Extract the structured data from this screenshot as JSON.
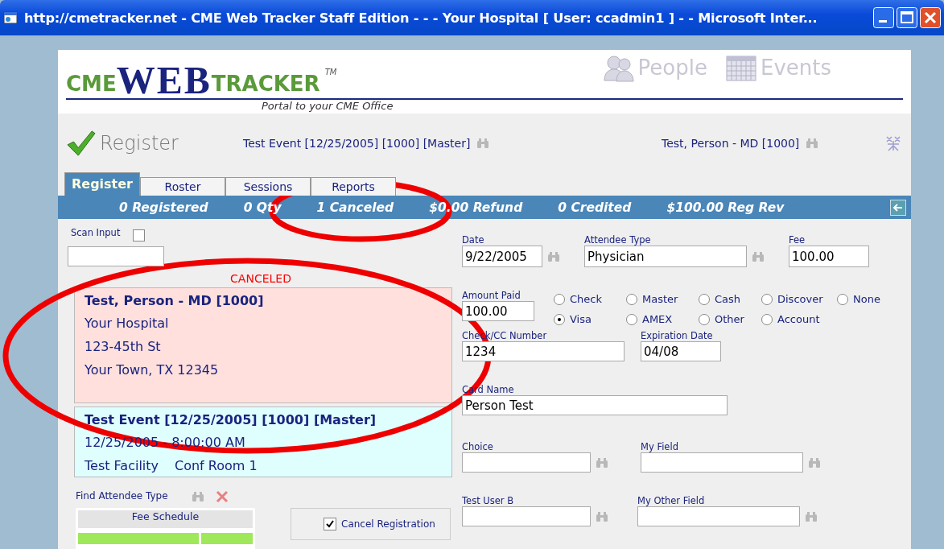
{
  "window": {
    "title": "http://cmetracker.net - CME Web Tracker Staff Edition - - - Your Hospital [ User: ccadmin1 ] -  - Microsoft Inter..."
  },
  "header": {
    "logo": {
      "part_1": "CME",
      "part_2": "WEB",
      "part_3": "TRACKER",
      "trademark": "TM",
      "tagline": "Portal to your CME Office"
    },
    "nav": [
      {
        "kind": "people",
        "label": "People"
      },
      {
        "kind": "events",
        "label": "Events"
      }
    ]
  },
  "page": {
    "title": "Register",
    "event": "Test Event [12/25/2005] [1000] [Master]",
    "attendee": "Test, Person - MD [1000]"
  },
  "tabs": [
    {
      "label": "Register",
      "selected": true
    },
    {
      "label": "Roster",
      "selected": false
    },
    {
      "label": "Sessions",
      "selected": false
    },
    {
      "label": "Reports",
      "selected": false
    }
  ],
  "stats": [
    "0 Registered",
    "0 Qty",
    "1 Canceled",
    "$0.00 Refund",
    "0 Credited",
    "$100.00 Reg Rev"
  ],
  "scan_input": {
    "label": "Scan Input",
    "checked": false
  },
  "status": "CANCELED",
  "attendee_card": {
    "name": "Test, Person - MD [1000]",
    "lines": [
      "Your Hospital",
      "123-45th St",
      "Your Town, TX 12345"
    ]
  },
  "event_card": {
    "name": "Test Event [12/25/2005] [1000] [Master]",
    "date": "12/25/2005 - 8:00:00 AM",
    "facility": "Test Facility",
    "room": "Conf Room 1"
  },
  "find_attendee_type": {
    "label": "Find Attendee Type"
  },
  "fee_schedule": {
    "title": "Fee Schedule"
  },
  "cancel_registration": {
    "label": "Cancel Registration",
    "checked": true
  },
  "form": [
    {
      "kind": "fields",
      "fields": [
        {
          "label": "Date",
          "value": "9/22/2005",
          "lookup": true
        },
        {
          "label": "Attendee Type",
          "value": "Physician",
          "lookup": true
        },
        {
          "label": "Fee",
          "value": "100.00",
          "lookup": false
        }
      ]
    },
    {
      "kind": "payment",
      "label": "Amount Paid",
      "value": "100.00",
      "options": [
        {
          "label": "Check",
          "selected": false
        },
        {
          "label": "Master",
          "selected": false
        },
        {
          "label": "Cash",
          "selected": false
        },
        {
          "label": "Discover",
          "selected": false
        },
        {
          "label": "None",
          "selected": false
        },
        {
          "label": "Visa",
          "selected": true
        },
        {
          "label": "AMEX",
          "selected": false
        },
        {
          "label": "Other",
          "selected": false
        },
        {
          "label": "Account",
          "selected": false
        }
      ]
    },
    {
      "kind": "fields",
      "fields": [
        {
          "label": "Check/CC Number",
          "value": "1234",
          "lookup": false
        },
        {
          "label": "Expiration Date",
          "value": "04/08",
          "lookup": false
        }
      ]
    },
    {
      "kind": "fields",
      "fields": [
        {
          "label": "Card Name",
          "value": "Person Test",
          "lookup": false
        }
      ]
    },
    {
      "kind": "fields",
      "fields": [
        {
          "label": "Choice",
          "lookup": true
        },
        {
          "label": "My Field",
          "lookup": true
        }
      ]
    },
    {
      "kind": "fields",
      "fields": [
        {
          "label": "Test User B",
          "lookup": true
        },
        {
          "label": "My Other Field",
          "lookup": true
        }
      ]
    }
  ],
  "annotations": [
    {
      "kind": "ellipse"
    },
    {
      "kind": "ellipse"
    }
  ]
}
